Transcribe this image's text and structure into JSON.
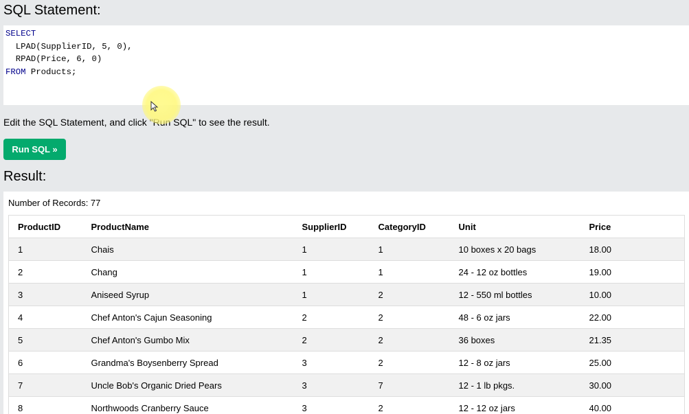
{
  "sql_section": {
    "title": "SQL Statement:",
    "code_lines": [
      {
        "keyword": "SELECT",
        "rest": ""
      },
      {
        "keyword": "",
        "rest": "  LPAD(SupplierID, 5, 0),"
      },
      {
        "keyword": "",
        "rest": "  RPAD(Price, 6, 0)"
      },
      {
        "keyword": "FROM",
        "rest": " Products;"
      }
    ]
  },
  "instruction_text": "Edit the SQL Statement, and click \"Run SQL\" to see the result.",
  "run_button_label": "Run SQL »",
  "result_section": {
    "title": "Result:",
    "records_label": "Number of Records: 77",
    "columns": [
      "ProductID",
      "ProductName",
      "SupplierID",
      "CategoryID",
      "Unit",
      "Price"
    ],
    "rows": [
      [
        "1",
        "Chais",
        "1",
        "1",
        "10 boxes x 20 bags",
        "18.00"
      ],
      [
        "2",
        "Chang",
        "1",
        "1",
        "24 - 12 oz bottles",
        "19.00"
      ],
      [
        "3",
        "Aniseed Syrup",
        "1",
        "2",
        "12 - 550 ml bottles",
        "10.00"
      ],
      [
        "4",
        "Chef Anton's Cajun Seasoning",
        "2",
        "2",
        "48 - 6 oz jars",
        "22.00"
      ],
      [
        "5",
        "Chef Anton's Gumbo Mix",
        "2",
        "2",
        "36 boxes",
        "21.35"
      ],
      [
        "6",
        "Grandma's Boysenberry Spread",
        "3",
        "2",
        "12 - 8 oz jars",
        "25.00"
      ],
      [
        "7",
        "Uncle Bob's Organic Dried Pears",
        "3",
        "7",
        "12 - 1 lb pkgs.",
        "30.00"
      ],
      [
        "8",
        "Northwoods Cranberry Sauce",
        "3",
        "2",
        "12 - 12 oz jars",
        "40.00"
      ]
    ]
  },
  "colors": {
    "page_background": "#e7e9eb",
    "button_green": "#04aa6d",
    "sql_keyword": "#00008b",
    "row_stripe": "#f1f1f1"
  },
  "icons": {
    "cursor": "mouse-pointer-icon"
  }
}
